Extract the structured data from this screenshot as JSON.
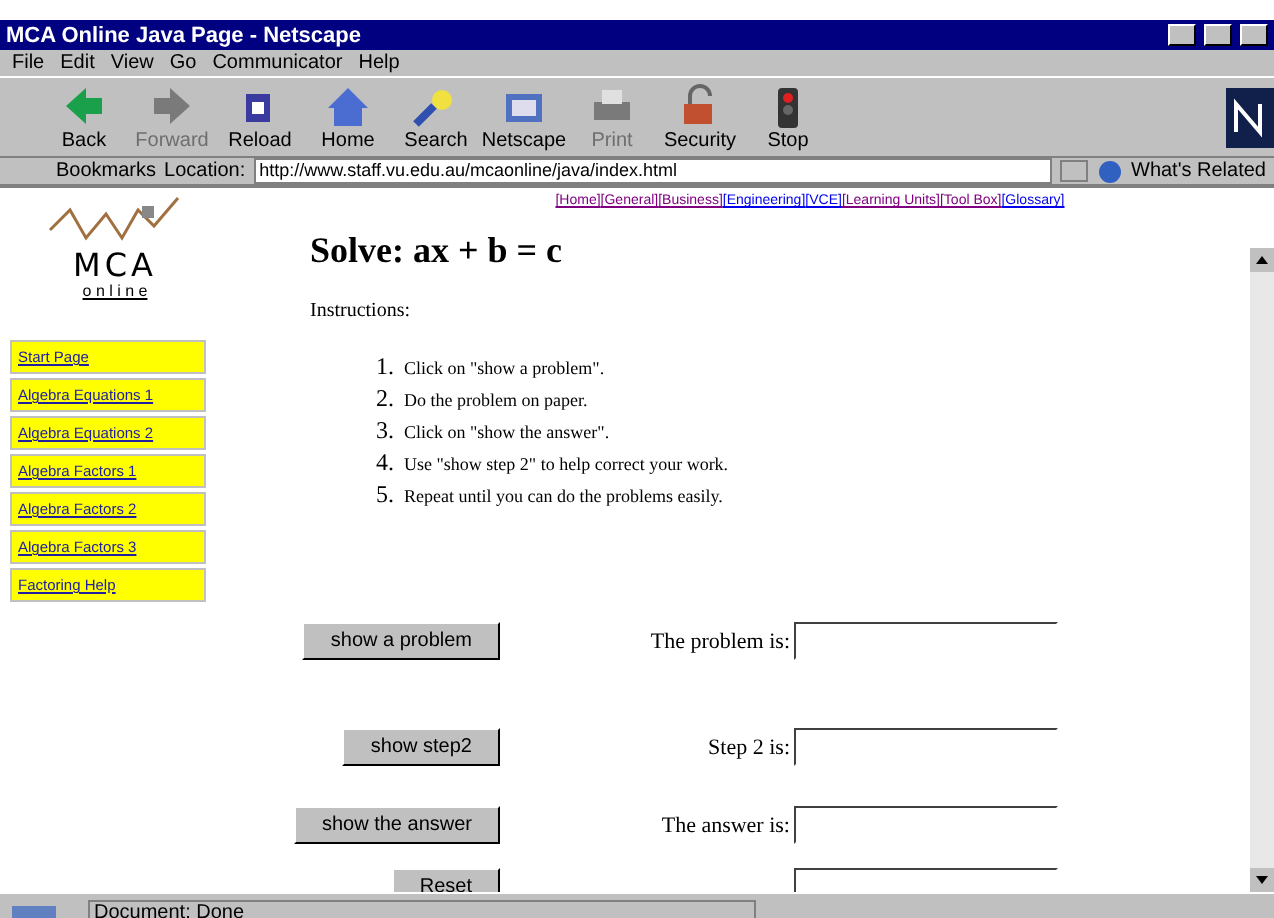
{
  "window": {
    "title": "MCA Online Java Page - Netscape"
  },
  "menu": [
    "File",
    "Edit",
    "View",
    "Go",
    "Communicator",
    "Help"
  ],
  "toolbar": [
    {
      "label": "Back",
      "kind": "back",
      "disabled": false
    },
    {
      "label": "Forward",
      "kind": "forward",
      "disabled": true
    },
    {
      "label": "Reload",
      "kind": "reload",
      "disabled": false
    },
    {
      "label": "Home",
      "kind": "home",
      "disabled": false
    },
    {
      "label": "Search",
      "kind": "search",
      "disabled": false
    },
    {
      "label": "Netscape",
      "kind": "netscape",
      "disabled": false
    },
    {
      "label": "Print",
      "kind": "print",
      "disabled": true
    },
    {
      "label": "Security",
      "kind": "security",
      "disabled": false
    },
    {
      "label": "Stop",
      "kind": "stop",
      "disabled": false
    }
  ],
  "location_bar": {
    "bookmarks": "Bookmarks",
    "location_label": "Location:",
    "url": "http://www.staff.vu.edu.au/mcaonline/java/index.html",
    "related": "What's Related"
  },
  "logo": {
    "title": "MCA",
    "subtitle": "o n l i n e"
  },
  "sidebar": {
    "items": [
      "Start Page",
      "Algebra Equations 1",
      "Algebra Equations 2",
      "Algebra Factors 1",
      "Algebra Factors 2",
      "Algebra Factors 3",
      "Factoring Help"
    ]
  },
  "top_links": [
    {
      "label": "[Home]",
      "visited": true
    },
    {
      "label": "[General]",
      "visited": true
    },
    {
      "label": "[Business]",
      "visited": true
    },
    {
      "label": "[Engineering]",
      "visited": false
    },
    {
      "label": "[VCE]",
      "visited": false
    },
    {
      "label": "[Learning Units]",
      "visited": true
    },
    {
      "label": "[Tool Box]",
      "visited": true
    },
    {
      "label": "[Glossary]",
      "visited": false
    }
  ],
  "heading": "Solve: ax + b = c",
  "instructions_label": "Instructions:",
  "instructions": [
    {
      "number": "1.",
      "text": "Click on \"show a problem\"."
    },
    {
      "number": "2.",
      "text": "Do the problem on paper."
    },
    {
      "number": "3.",
      "text": "Click on \"show the answer\"."
    },
    {
      "number": "4.",
      "text": "Use \"show step 2\" to help correct your work."
    },
    {
      "number": "5.",
      "text": "Repeat until you can do the problems easily."
    }
  ],
  "form": [
    {
      "button": "show a problem",
      "label": "The problem is:"
    },
    {
      "button": "show step2",
      "label": "Step 2 is:"
    },
    {
      "button": "show the answer",
      "label": "The answer is:"
    },
    {
      "button": "Reset"
    }
  ],
  "status_bar": {
    "text": "Document: Done"
  }
}
